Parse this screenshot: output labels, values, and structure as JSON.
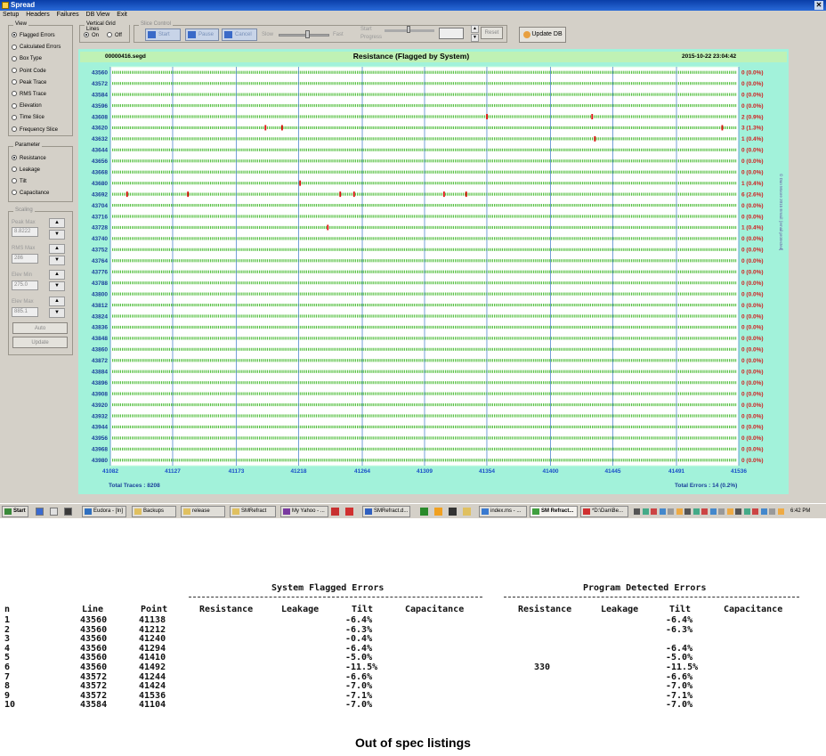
{
  "window": {
    "title": "Spread",
    "close": "✕"
  },
  "menu": [
    "Setup",
    "Headers",
    "Failures",
    "DB View",
    "Exit"
  ],
  "view": {
    "title": "View",
    "options": [
      "Flagged Errors",
      "Calculated Errors",
      "Box Type",
      "Point Code",
      "Peak Trace",
      "RMS Trace",
      "Elevation",
      "Time Slice",
      "Frequency Slice"
    ],
    "selected": 0
  },
  "parameter": {
    "title": "Parameter",
    "options": [
      "Resistance",
      "Leakage",
      "Tilt",
      "Capacitance"
    ],
    "selected": 0
  },
  "scaling": {
    "title": "Scaling",
    "fields": [
      {
        "label": "Peak Max",
        "value": "8.8222"
      },
      {
        "label": "RMS Max",
        "value": "286"
      },
      {
        "label": "Elev Min",
        "value": "275.0"
      },
      {
        "label": "Elev Max",
        "value": "885.1"
      }
    ],
    "auto_label": "Auto",
    "update_label": "Update"
  },
  "vgrid": {
    "title": "Vertical Grid Lines",
    "on": "On",
    "off": "Off",
    "selected": "On"
  },
  "slice": {
    "title": "Slice Control",
    "start": "Start",
    "pause": "Pause",
    "cancel": "Cancel",
    "slow": "Slow",
    "fast": "Fast",
    "start_label": "Start",
    "progress_label": "Progress",
    "reset": "Reset"
  },
  "update_db": "Update DB",
  "chart_data": {
    "type": "heatmap",
    "file": "00000416.segd",
    "title": "Resistance (Flagged by System)",
    "timestamp": "2015-10-22 23:04:42",
    "rows": [
      "43560",
      "43572",
      "43584",
      "43596",
      "43608",
      "43620",
      "43632",
      "43644",
      "43656",
      "43668",
      "43680",
      "43692",
      "43704",
      "43716",
      "43728",
      "43740",
      "43752",
      "43764",
      "43776",
      "43788",
      "43800",
      "43812",
      "43824",
      "43836",
      "43848",
      "43860",
      "43872",
      "43884",
      "43896",
      "43908",
      "43920",
      "43932",
      "43944",
      "43956",
      "43968",
      "43980"
    ],
    "right_labels": [
      "0 (0.0%)",
      "0 (0.0%)",
      "0 (0.0%)",
      "0 (0.0%)",
      "2 (0.9%)",
      "3 (1.3%)",
      "1 (0.4%)",
      "0 (0.0%)",
      "0 (0.0%)",
      "0 (0.0%)",
      "1 (0.4%)",
      "6 (2.6%)",
      "0 (0.0%)",
      "0 (0.0%)",
      "1 (0.4%)",
      "0 (0.0%)",
      "0 (0.0%)",
      "0 (0.0%)",
      "0 (0.0%)",
      "0 (0.0%)",
      "0 (0.0%)",
      "0 (0.0%)",
      "0 (0.0%)",
      "0 (0.0%)",
      "0 (0.0%)",
      "0 (0.0%)",
      "0 (0.0%)",
      "0 (0.0%)",
      "0 (0.0%)",
      "0 (0.0%)",
      "0 (0.0%)",
      "0 (0.0%)",
      "0 (0.0%)",
      "0 (0.0%)",
      "0 (0.0%)",
      "0 (0.0%)"
    ],
    "xticks": [
      41082,
      41127,
      41173,
      41218,
      41264,
      41309,
      41354,
      41400,
      41445,
      41491,
      41536
    ],
    "xlim": [
      41082,
      41536
    ],
    "errors": [
      {
        "row": 4,
        "x": 41354
      },
      {
        "row": 4,
        "x": 41430
      },
      {
        "row": 5,
        "x": 41194
      },
      {
        "row": 5,
        "x": 41206
      },
      {
        "row": 5,
        "x": 41524
      },
      {
        "row": 6,
        "x": 41432
      },
      {
        "row": 10,
        "x": 41219
      },
      {
        "row": 11,
        "x": 41094
      },
      {
        "row": 11,
        "x": 41138
      },
      {
        "row": 11,
        "x": 41248
      },
      {
        "row": 11,
        "x": 41258
      },
      {
        "row": 11,
        "x": 41323
      },
      {
        "row": 11,
        "x": 41339
      },
      {
        "row": 14,
        "x": 41239
      }
    ],
    "total_traces": "Total Traces : 8208",
    "total_errors": "Total Errors : 14 (0.2%)",
    "side_note": "© Dan Moore 2015   Email: [email protected]",
    "grid": true
  },
  "taskbar": {
    "start": "Start",
    "items": [
      "Eudora - [In]",
      "Backups",
      "release",
      "SMRefract",
      "My Yahoo - ...",
      "SMRefract.d...",
      "index.ms - ...",
      "SM Refract...",
      "*D:\\Dan\\Be..."
    ],
    "clock": "6:42 PM"
  },
  "listing": {
    "group1": "System Flagged Errors",
    "group2": "Program Detected Errors",
    "headers": [
      "n",
      "Line",
      "Point",
      "Resistance",
      "Leakage",
      "Tilt",
      "Capacitance",
      "Resistance",
      "Leakage",
      "Tilt",
      "Capacitance"
    ],
    "rows": [
      [
        "1",
        "43560",
        "41138",
        "",
        "",
        "-6.4%",
        "",
        "",
        "",
        "-6.4%",
        ""
      ],
      [
        "2",
        "43560",
        "41212",
        "",
        "",
        "-6.3%",
        "",
        "",
        "",
        "-6.3%",
        ""
      ],
      [
        "3",
        "43560",
        "41240",
        "",
        "",
        "-0.4%",
        "",
        "",
        "",
        "",
        ""
      ],
      [
        "4",
        "43560",
        "41294",
        "",
        "",
        "-6.4%",
        "",
        "",
        "",
        "-6.4%",
        ""
      ],
      [
        "5",
        "43560",
        "41410",
        "",
        "",
        "-5.0%",
        "",
        "",
        "",
        "-5.0%",
        ""
      ],
      [
        "6",
        "43560",
        "41492",
        "",
        "",
        "-11.5%",
        "",
        "330",
        "",
        "-11.5%",
        ""
      ],
      [
        "7",
        "43572",
        "41244",
        "",
        "",
        "-6.6%",
        "",
        "",
        "",
        "-6.6%",
        ""
      ],
      [
        "8",
        "43572",
        "41424",
        "",
        "",
        "-7.0%",
        "",
        "",
        "",
        "-7.0%",
        ""
      ],
      [
        "9",
        "43572",
        "41536",
        "",
        "",
        "-7.1%",
        "",
        "",
        "",
        "-7.1%",
        ""
      ],
      [
        "10",
        "43584",
        "41104",
        "",
        "",
        "-7.0%",
        "",
        "",
        "",
        "-7.0%",
        ""
      ]
    ]
  },
  "caption": "Out of spec listings"
}
